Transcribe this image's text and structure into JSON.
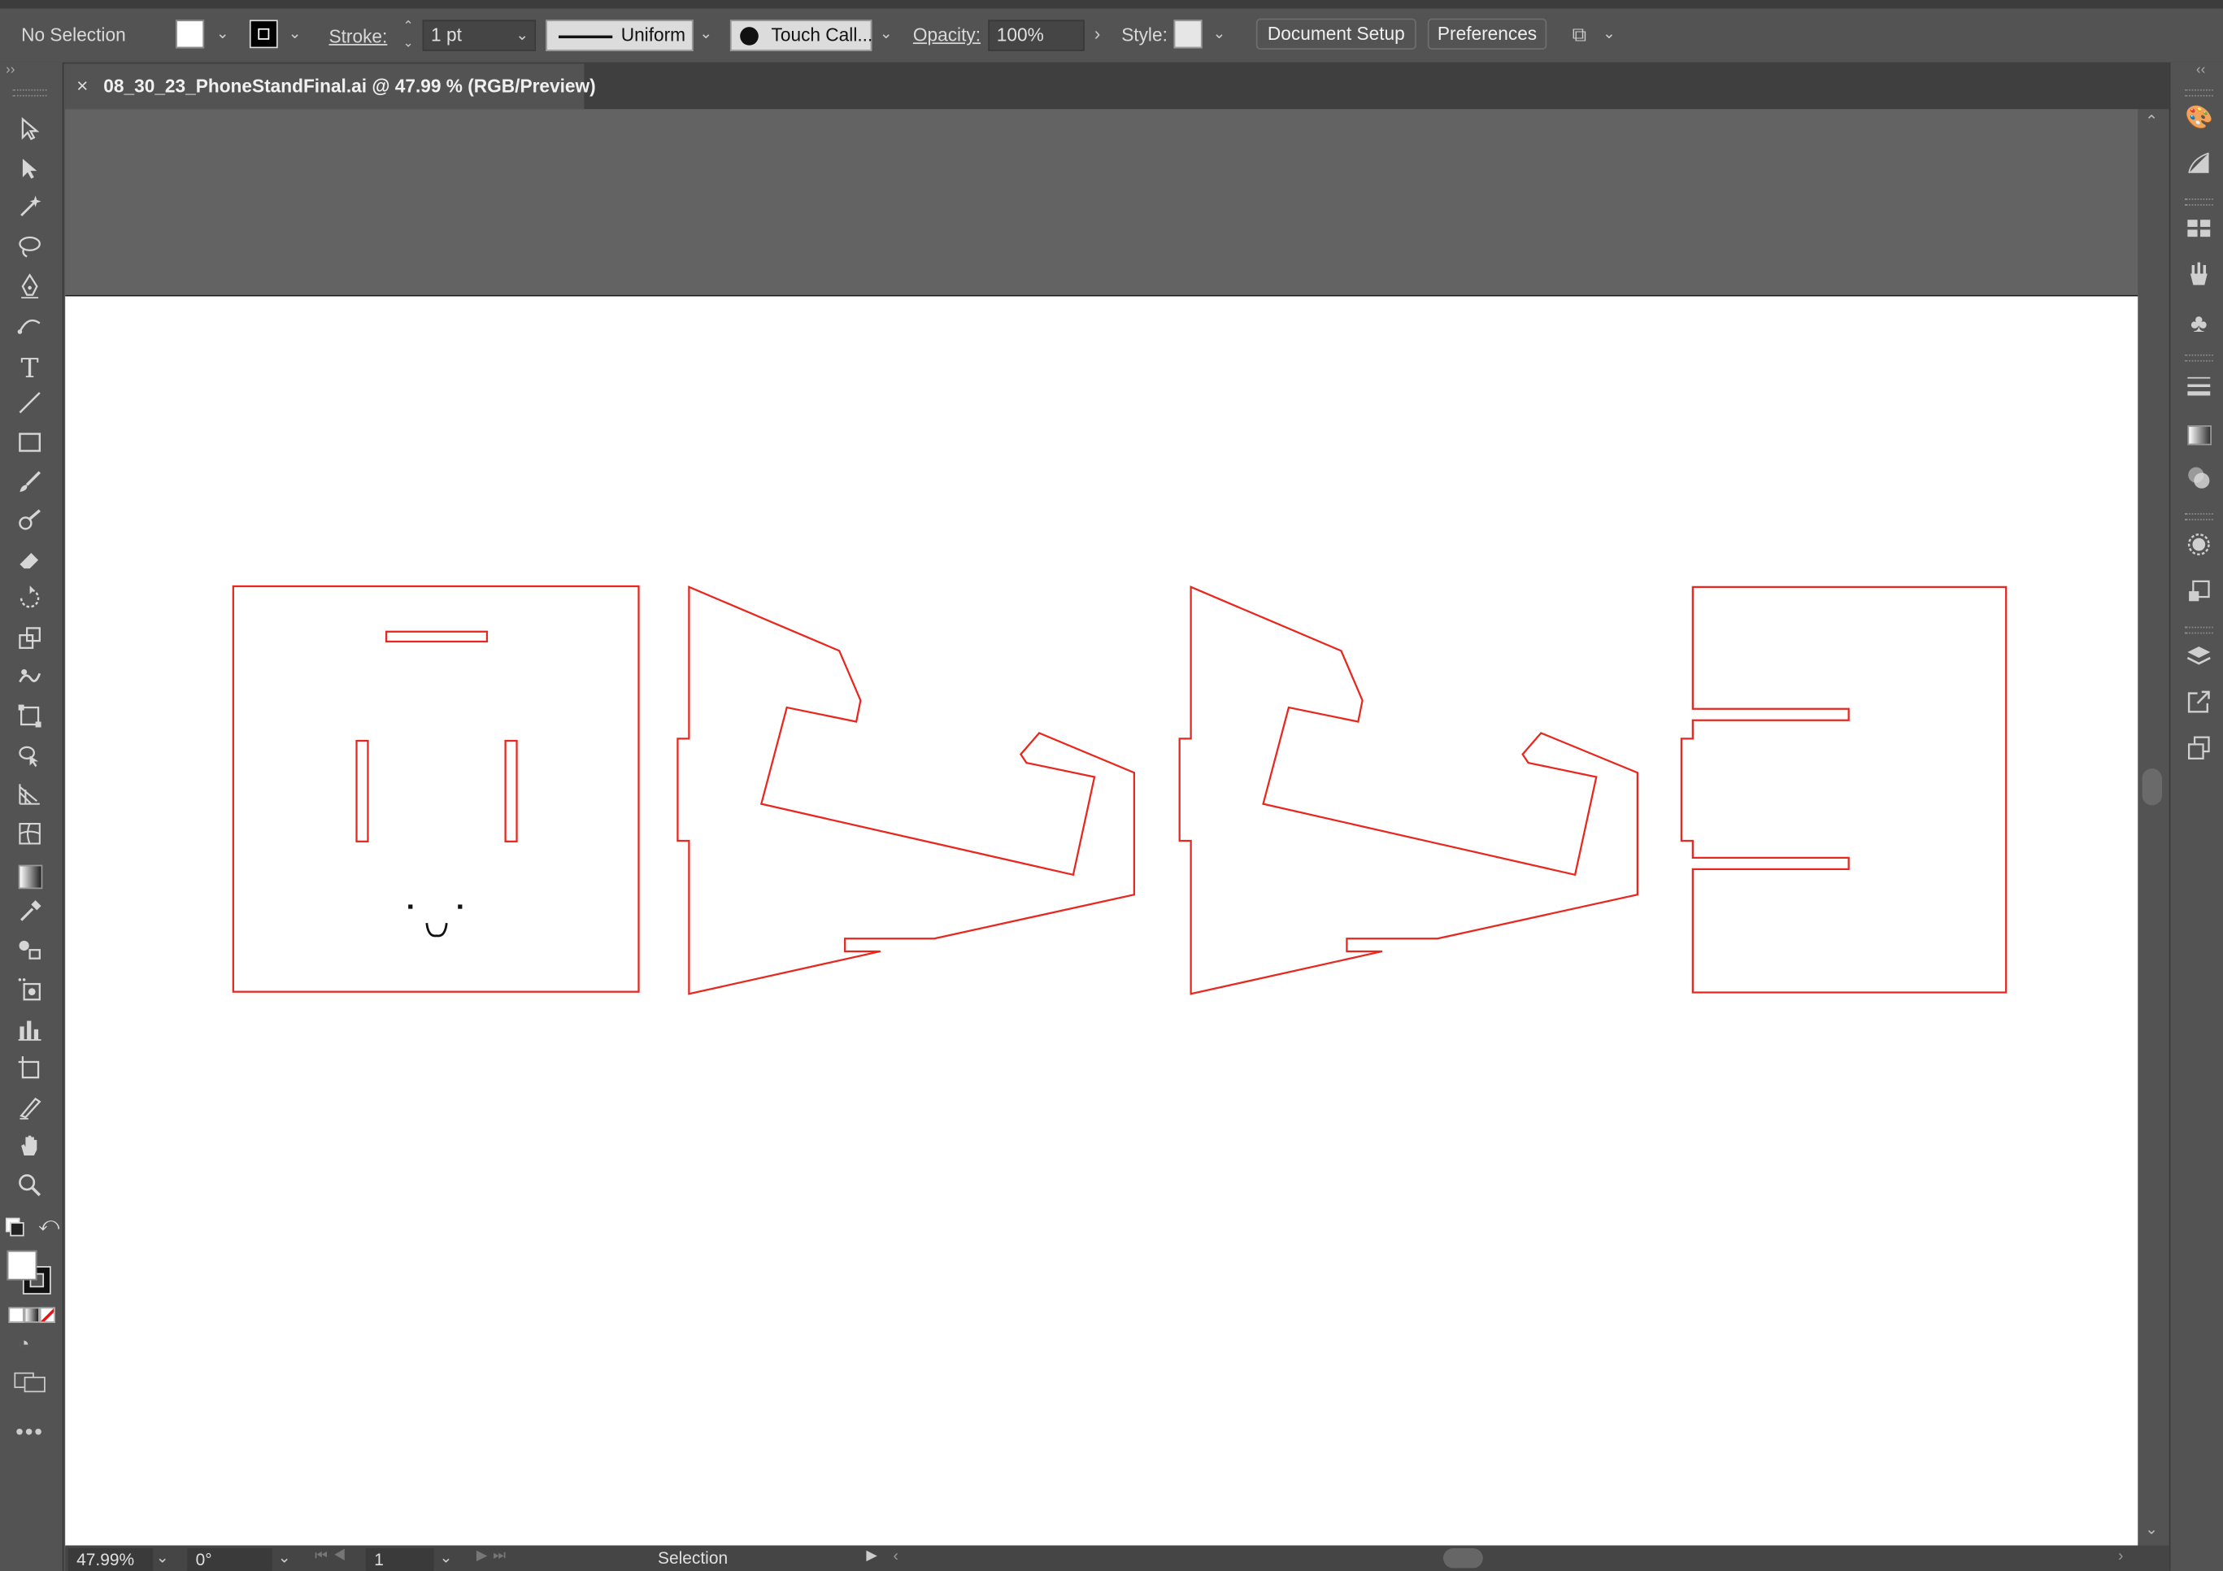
{
  "control_bar": {
    "selection_status": "No Selection",
    "stroke_label": "Stroke:",
    "stroke_weight": "1 pt",
    "profile_label": "Uniform",
    "brush_label": "Touch Call...",
    "opacity_label": "Opacity:",
    "opacity_value": "100%",
    "style_label": "Style:",
    "document_setup_label": "Document Setup",
    "preferences_label": "Preferences"
  },
  "document_tab": {
    "close_glyph": "×",
    "title": "08_30_23_PhoneStandFinal.ai @ 47.99 % (RGB/Preview)"
  },
  "status_bar": {
    "zoom": "47.99%",
    "rotation": "0°",
    "artboard_number": "1",
    "current_tool": "Selection"
  },
  "colors": {
    "cut_line": "#e8271e",
    "artboard": "#ffffff",
    "pasteboard": "#636363",
    "ui_panel": "#535353"
  },
  "icons": {
    "toolbar": [
      "selection-icon",
      "direct-selection-icon",
      "magic-wand-icon",
      "lasso-icon",
      "pen-icon",
      "curvature-icon",
      "type-icon",
      "line-icon",
      "rectangle-icon",
      "paintbrush-icon",
      "blob-brush-icon",
      "eraser-icon",
      "rotate-icon",
      "scale-icon",
      "warp-icon",
      "free-transform-icon",
      "shape-builder-icon",
      "perspective-grid-icon",
      "mesh-icon",
      "gradient-icon",
      "eyedropper-icon",
      "blend-icon",
      "symbol-sprayer-icon",
      "column-graph-icon",
      "artboard-icon",
      "slice-icon",
      "hand-icon",
      "zoom-icon"
    ],
    "right_panel": [
      "color-icon",
      "color-guide-icon",
      "swatches-icon",
      "brushes-icon",
      "symbols-icon",
      "stroke-icon",
      "gradient-icon",
      "transparency-icon",
      "appearance-icon",
      "graphic-styles-icon",
      "layers-icon",
      "asset-export-icon",
      "artboards-icon"
    ]
  }
}
